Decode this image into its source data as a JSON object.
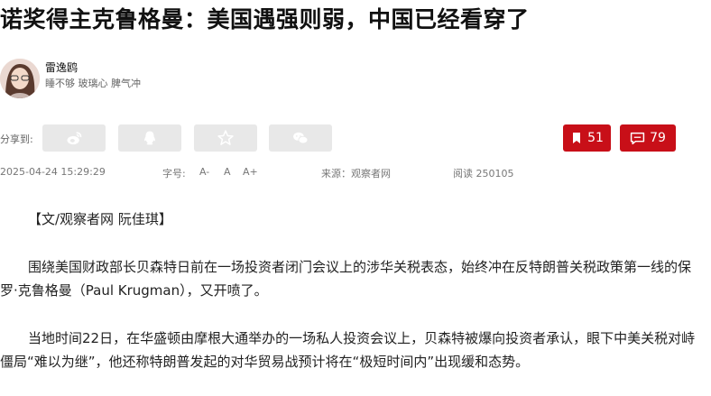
{
  "article": {
    "title": "诺奖得主克鲁格曼：美国遇强则弱，中国已经看穿了"
  },
  "author": {
    "name": "雷逸鸥",
    "tags": "睡不够 玻璃心 脾气冲"
  },
  "share": {
    "label": "分享到:",
    "buttons": [
      {
        "icon": "weibo-icon"
      },
      {
        "icon": "qq-icon"
      },
      {
        "icon": "qzone-star-icon"
      },
      {
        "icon": "wechat-icon"
      }
    ],
    "bookmark_count": "51",
    "comment_count": "79"
  },
  "meta": {
    "datetime": "2025-04-24 15:29:29",
    "font_size_label": "字号:",
    "font_small": "A-",
    "font_normal": "A",
    "font_large": "A+",
    "source": "来源：观察者网",
    "reads": "阅读 250105"
  },
  "body": {
    "byline": "【文/观察者网 阮佳琪】",
    "paragraphs": [
      "围绕美国财政部长贝森特日前在一场投资者闭门会议上的涉华关税表态，始终冲在反特朗普关税政策第一线的保罗·克鲁格曼（Paul Krugman），又开喷了。",
      "当地时间22日，在华盛顿由摩根大通举办的一场私人投资会议上，贝森特被爆向投资者承认，眼下中美关税对峙僵局“难以为继”，他还称特朗普发起的对华贸易战预计将在“极短时间内”出现缓和态势。"
    ]
  },
  "colors": {
    "accent": "#c80f18",
    "share_bg": "#e8e8e8"
  }
}
